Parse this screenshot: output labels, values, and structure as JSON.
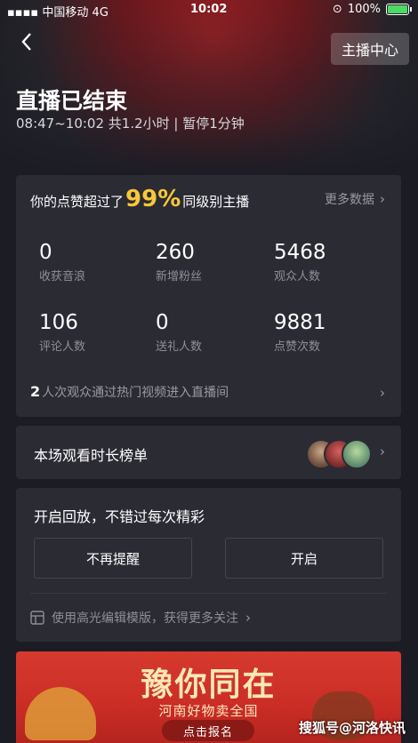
{
  "status_bar": {
    "carrier": "中国移动",
    "network": "4G",
    "time": "10:02",
    "battery": "100%"
  },
  "header": {
    "anchor_center": "主播中心",
    "title": "直播已结束",
    "subtitle": "08:47~10:02 共1.2小时 | 暂停1分钟"
  },
  "likes": {
    "prefix": "你的点赞超过了",
    "percent": "99%",
    "suffix": "同级别主播",
    "more": "更多数据"
  },
  "stats": [
    {
      "value": "0",
      "label": "收获音浪"
    },
    {
      "value": "260",
      "label": "新增粉丝"
    },
    {
      "value": "5468",
      "label": "观众人数"
    },
    {
      "value": "106",
      "label": "评论人数"
    },
    {
      "value": "0",
      "label": "送礼人数"
    },
    {
      "value": "9881",
      "label": "点赞次数"
    }
  ],
  "hot_video": {
    "count": "2",
    "text": "人次观众通过热门视频进入直播间"
  },
  "rank": {
    "label": "本场观看时长榜单"
  },
  "replay": {
    "title": "开启回放，不错过每次精彩",
    "dismiss": "不再提醒",
    "enable": "开启",
    "tip": "使用高光编辑模版，获得更多关注"
  },
  "banner": {
    "headline": "豫你同在",
    "subline": "河南好物卖全国",
    "cta": "点击报名"
  },
  "watermark": "搜狐号@河洛快讯",
  "colors": {
    "accent_gold": "#f8c73a",
    "card_bg": "#2b2b34",
    "page_bg": "#1c1c24"
  }
}
